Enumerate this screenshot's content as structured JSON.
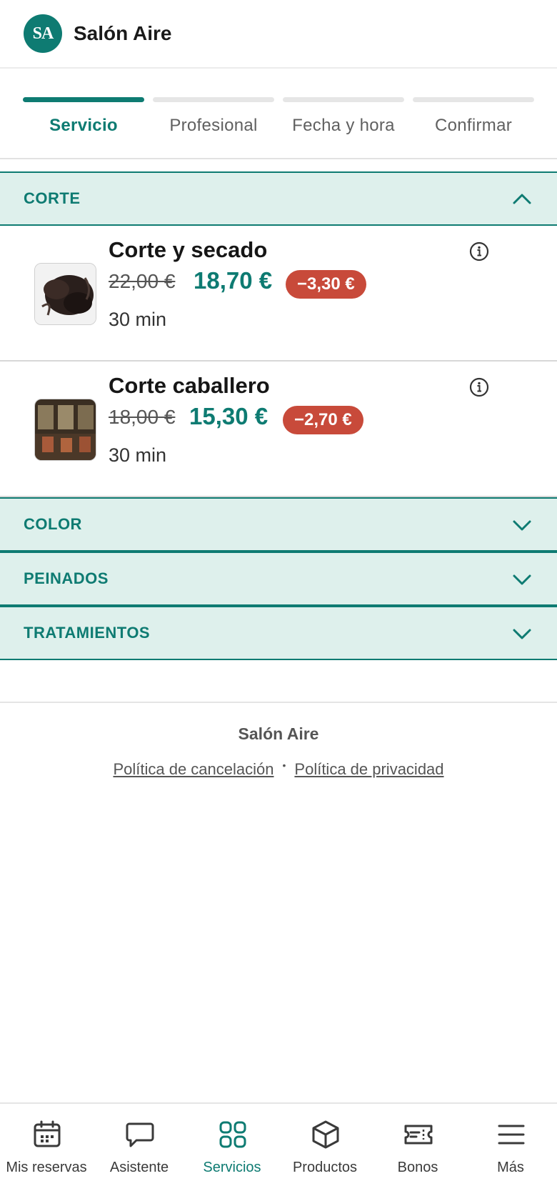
{
  "header": {
    "logo_initials": "SA",
    "title": "Salón Aire"
  },
  "stepper": {
    "steps": [
      {
        "label": "Servicio",
        "active": true
      },
      {
        "label": "Profesional",
        "active": false
      },
      {
        "label": "Fecha y hora",
        "active": false
      },
      {
        "label": "Confirmar",
        "active": false
      }
    ]
  },
  "categories": [
    {
      "label": "CORTE",
      "expanded": true,
      "services": [
        {
          "name": "Corte y secado",
          "old_price": "22,00 €",
          "new_price": "18,70 €",
          "discount": "−3,30 €",
          "duration": "30 min",
          "thumb": "hair-photo"
        },
        {
          "name": "Corte caballero",
          "old_price": "18,00 €",
          "new_price": "15,30 €",
          "discount": "−2,70 €",
          "duration": "30 min",
          "thumb": "salon-photo"
        }
      ]
    },
    {
      "label": "COLOR",
      "expanded": false
    },
    {
      "label": "PEINADOS",
      "expanded": false
    },
    {
      "label": "TRATAMIENTOS",
      "expanded": false
    }
  ],
  "footer": {
    "name": "Salón Aire",
    "cancel_policy": "Política de cancelación",
    "separator": "•",
    "privacy_policy": "Política de privacidad"
  },
  "bottom_nav": [
    {
      "label": "Mis reservas",
      "icon": "calendar-icon",
      "active": false
    },
    {
      "label": "Asistente",
      "icon": "chat-icon",
      "active": false
    },
    {
      "label": "Servicios",
      "icon": "grid-icon",
      "active": true
    },
    {
      "label": "Productos",
      "icon": "box-icon",
      "active": false
    },
    {
      "label": "Bonos",
      "icon": "ticket-icon",
      "active": false
    },
    {
      "label": "Más",
      "icon": "menu-icon",
      "active": false
    }
  ],
  "colors": {
    "accent": "#0e7b72",
    "category_bg": "#def0ec",
    "discount_bg": "#c84a3a"
  }
}
